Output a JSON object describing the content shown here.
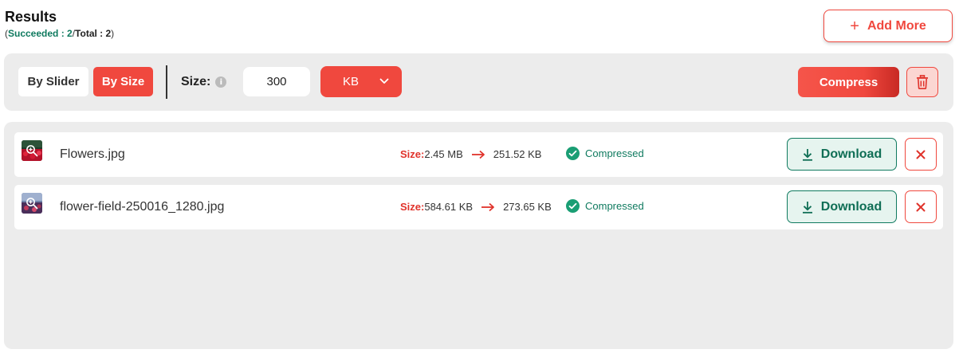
{
  "header": {
    "title": "Results",
    "open_paren": "(",
    "succeeded_label": "Succeeded : 2",
    "slash": "/",
    "total_label": "Total : 2",
    "close_paren": ")"
  },
  "add_more": {
    "label": "Add More",
    "icon": "plus-icon"
  },
  "toolbar": {
    "mode_options": [
      "By Slider",
      "By Size"
    ],
    "mode_slider_label": "By Slider",
    "mode_size_label": "By Size",
    "selected_mode": "By Size",
    "size_label": "Size:",
    "size_value": "300",
    "unit_value": "KB",
    "compress_label": "Compress",
    "delete_icon": "trash-icon"
  },
  "files": [
    {
      "name": "Flowers.jpg",
      "size_label": "Size:",
      "original_size": "2.45 MB",
      "compressed_size": "251.52 KB",
      "status": "Compressed",
      "download_label": "Download"
    },
    {
      "name": "flower-field-250016_1280.jpg",
      "size_label": "Size:",
      "original_size": "584.61 KB",
      "compressed_size": "273.65 KB",
      "status": "Compressed",
      "download_label": "Download"
    }
  ],
  "colors": {
    "accent": "#f0483e",
    "success": "#0f7a5f",
    "panel_bg": "#ececec"
  }
}
